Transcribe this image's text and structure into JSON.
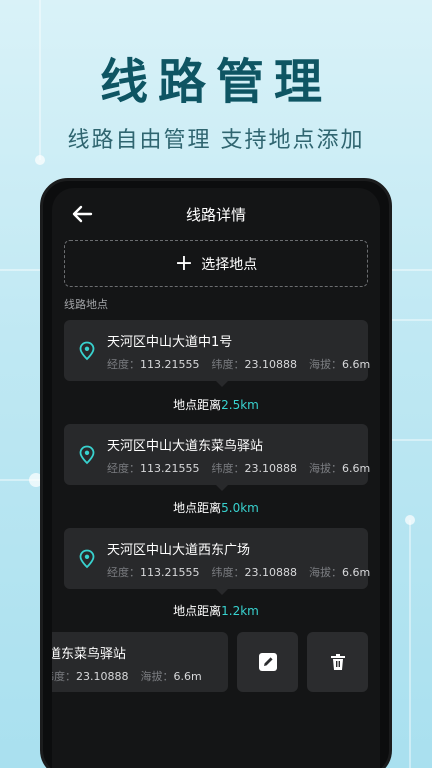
{
  "promo": {
    "title": "线路管理",
    "subtitle": "线路自由管理  支持地点添加"
  },
  "header": {
    "title": "线路详情",
    "back_icon": "arrow-left-icon"
  },
  "add_location": {
    "label": "选择地点",
    "icon": "plus-icon"
  },
  "section_label": "线路地点",
  "labels": {
    "lng": "经度：",
    "lat": "纬度：",
    "alt": "海拔：",
    "distance_prefix": "地点距离"
  },
  "locations": [
    {
      "name": "天河区中山大道中1号",
      "lng": "113.21555",
      "lat": "23.10888",
      "alt": "6.6m"
    },
    {
      "name": "天河区中山大道东菜鸟驿站",
      "lng": "113.21555",
      "lat": "23.10888",
      "alt": "6.6m"
    },
    {
      "name": "天河区中山大道西东广场",
      "lng": "113.21555",
      "lat": "23.10888",
      "alt": "6.6m"
    }
  ],
  "distances": [
    "2.5km",
    "5.0km",
    "1.2km"
  ],
  "swiped_item": {
    "name": "道东菜鸟驿站",
    "lat": "23.10888",
    "alt": "6.6m"
  },
  "actions": {
    "edit_icon": "edit-icon",
    "delete_icon": "trash-icon"
  },
  "colors": {
    "accent": "#38d2cf",
    "title": "#0e5563",
    "card": "#28292b"
  }
}
